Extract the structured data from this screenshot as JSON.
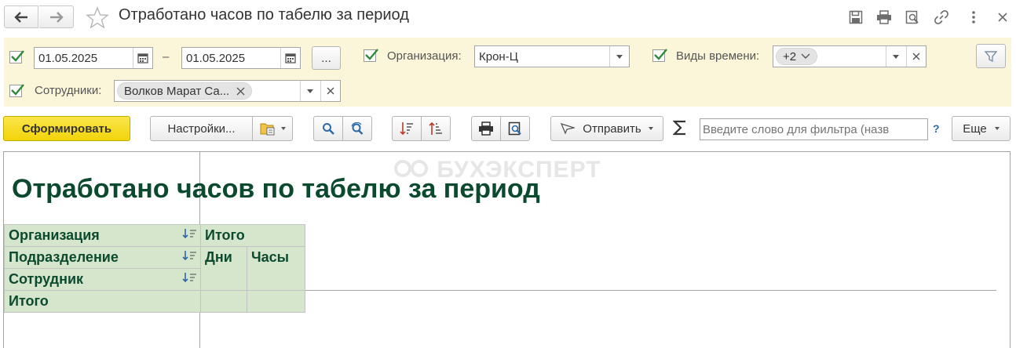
{
  "window": {
    "title": "Отработано часов по табелю за период"
  },
  "filters": {
    "period_from": "01.05.2025",
    "period_dash": "–",
    "period_to": "01.05.2025",
    "period_more": "...",
    "org_label": "Организация:",
    "org_value": "Крон-Ц",
    "time_types_label": "Виды времени:",
    "time_types_value": "+2",
    "employees_label": "Сотрудники:",
    "employees_value": "Волков Марат Са..."
  },
  "toolbar": {
    "generate_label": "Сформировать",
    "settings_label": "Настройки...",
    "send_label": "Отправить",
    "filter_placeholder": "Введите слово для фильтра (назв",
    "help_label": "?",
    "more_label": "Еще"
  },
  "report": {
    "title": "Отработано часов по табелю за период",
    "watermark": "БУХЭКСПЕРТ",
    "rows": [
      "Организация",
      "Подразделение",
      "Сотрудник",
      "Итого"
    ],
    "total_header": "Итого",
    "col_days": "Дни",
    "col_hours": "Часы"
  },
  "colors": {
    "accent_yellow": "#f5dd0d",
    "filter_bg": "#fbf6d9",
    "header_cell_bg": "#d6e6cc",
    "report_title": "#0c4a2f",
    "checkbox_green": "#2e8b3a"
  }
}
